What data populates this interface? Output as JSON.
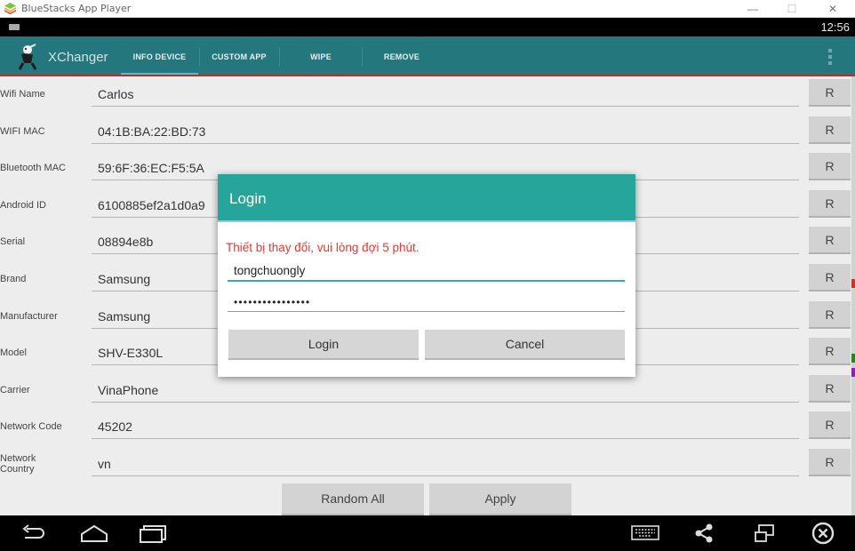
{
  "window": {
    "title": "BlueStacks App Player",
    "minimize": "—",
    "maximize": "☐",
    "close": "✕"
  },
  "status_bar": {
    "time": "12:56"
  },
  "app": {
    "title": "XChanger",
    "tabs": [
      {
        "label": "INFO DEVICE",
        "active": true
      },
      {
        "label": "CUSTOM APP",
        "active": false
      },
      {
        "label": "WIPE",
        "active": false
      },
      {
        "label": "REMOVE",
        "active": false
      }
    ],
    "accent_color": "#23777d"
  },
  "fields": [
    {
      "label": "Wifi Name",
      "value": "Carlos",
      "button": "R"
    },
    {
      "label": "WIFI MAC",
      "value": "04:1B:BA:22:BD:73",
      "button": "R"
    },
    {
      "label": "Bluetooth MAC",
      "value": "59:6F:36:EC:F5:5A",
      "button": "R"
    },
    {
      "label": "Android ID",
      "value": "6100885ef2a1d0a9",
      "button": "R"
    },
    {
      "label": "Serial",
      "value": "08894e8b",
      "button": "R"
    },
    {
      "label": "Brand",
      "value": "Samsung",
      "button": "R"
    },
    {
      "label": "Manufacturer",
      "value": "Samsung",
      "button": "R"
    },
    {
      "label": "Model",
      "value": "SHV-E330L",
      "button": "R"
    },
    {
      "label": "Carrier",
      "value": "VinaPhone",
      "button": "R"
    },
    {
      "label": "Network Code",
      "value": "45202",
      "button": "R"
    },
    {
      "label": "Network Country",
      "value": "vn",
      "button": "R"
    }
  ],
  "actions": {
    "random_all": "Random All",
    "apply": "Apply"
  },
  "dialog": {
    "title": "Login",
    "message": "Thiết bị thay đổi, vui lòng đợi 5 phút.",
    "username": "tongchuongly",
    "password_mask": "••••••••••••••••",
    "login_button": "Login",
    "cancel_button": "Cancel",
    "header_color": "#26a69a",
    "message_color": "#e53935"
  },
  "nav_icons": [
    "back-icon",
    "home-icon",
    "recent-apps-icon",
    "keyboard-icon",
    "share-icon",
    "multi-window-icon",
    "close-app-icon"
  ]
}
